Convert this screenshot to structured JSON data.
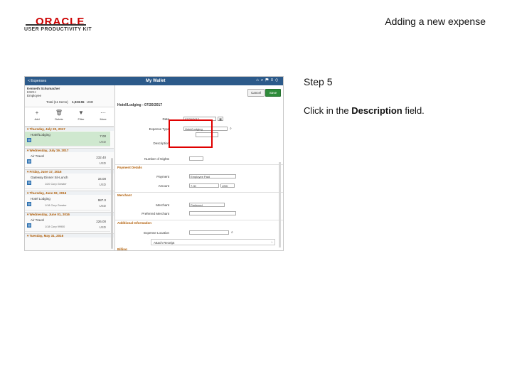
{
  "header": {
    "logo_brand": "ORACLE",
    "logo_product": "USER PRODUCTIVITY KIT",
    "slide_title": "Adding a new expense"
  },
  "step": {
    "label": "Step 5",
    "instruction_prefix": "Click in the ",
    "instruction_bold": "Description",
    "instruction_suffix": " field."
  },
  "app": {
    "back_label": "< Expenses",
    "title": "My Wallet",
    "user_name": "Kenneth Schumacher",
    "user_id": "KSCH",
    "user_role": "Employee",
    "total_label": "Total (11 Items)",
    "total_value": "1,023.55",
    "total_currency": "USD",
    "tools": [
      {
        "glyph": "+",
        "label": "Add"
      },
      {
        "glyph": "🗑",
        "label": "Delete"
      },
      {
        "glyph": "▼",
        "label": "Filter"
      },
      {
        "glyph": "⋯",
        "label": "More"
      }
    ],
    "groups": [
      {
        "label": "▾ Thursday, July 20, 2017",
        "items": [
          {
            "title": "Hotel/Lodging",
            "amount": "7.00",
            "currency": "USD",
            "sub": "",
            "selected": true
          }
        ]
      },
      {
        "label": "▾ Wednesday, July 19, 2017",
        "items": [
          {
            "title": "Air Travel",
            "amount": "232.40",
            "currency": "USD",
            "sub": "",
            "selected": false
          }
        ]
      },
      {
        "label": "▾ Friday, June 17, 2016",
        "items": [
          {
            "title": "Gateway Dinner Sit-Lunch",
            "amount": "34.00",
            "currency": "USD",
            "sub": "1/20 Corp Greater",
            "selected": false
          }
        ]
      },
      {
        "label": "▾ Thursday, June 02, 2016",
        "items": [
          {
            "title": "Hotel Lodging",
            "amount": "987.0",
            "currency": "USD",
            "sub": "1/18 Corp Greater",
            "selected": false
          }
        ]
      },
      {
        "label": "▾ Wednesday, June 01, 2016",
        "items": [
          {
            "title": "Air Travel",
            "amount": "226.00",
            "currency": "USD",
            "sub": "1/18 Corp 99900",
            "selected": false
          }
        ]
      },
      {
        "label": "▾ Tuesday, May 31, 2016",
        "items": []
      }
    ],
    "detail": {
      "title": "Hotel/Lodging - 07/20/2017",
      "cancel_label": "Cancel",
      "save_label": "Save",
      "date_label": "Date",
      "date_value": "07/20/2017",
      "expense_type_label": "Expense Type",
      "expense_type_value": "Hotel/Lodging",
      "description_label": "Description",
      "nights_label": "Number of Nights",
      "payment_section": "Payment Details",
      "payment_label": "Payment",
      "payment_value": "Employee Paid",
      "amount_label": "Amount",
      "amount_value": "7.00",
      "amount_currency": "USD",
      "merchant_section": "Merchant",
      "merchant_label": "Merchant",
      "merchant_value": "Preferred",
      "preferred_merchant_label": "Preferred Merchant",
      "additional_section": "Additional Information",
      "expense_location_label": "Expense Location",
      "attach_receipt_label": "Attach Receipt",
      "next_section": "Billing"
    }
  }
}
